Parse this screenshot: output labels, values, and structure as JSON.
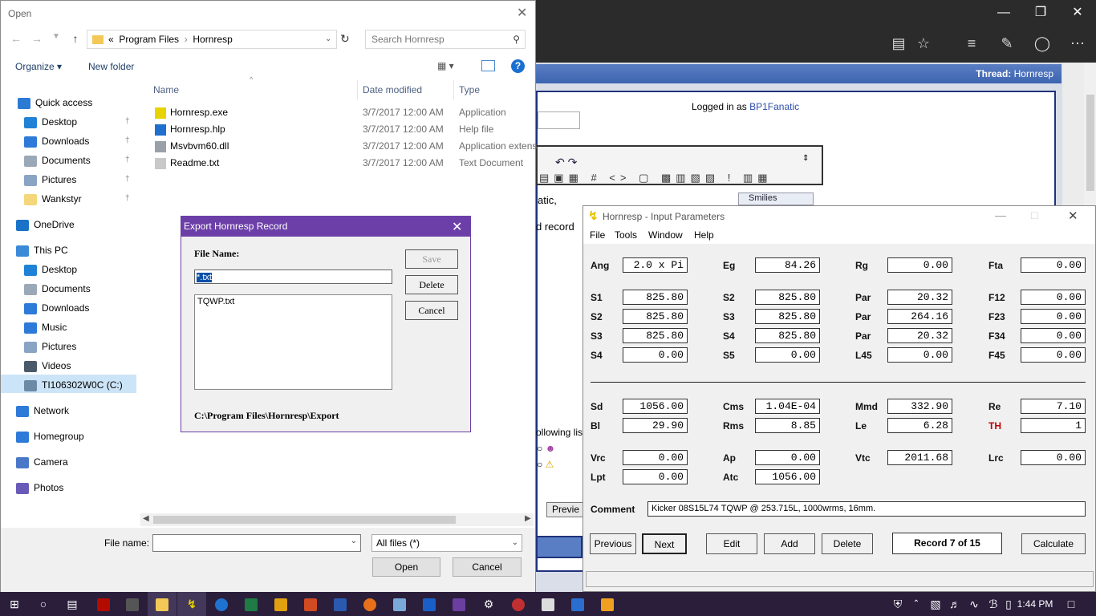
{
  "browser": {
    "thread_label": "Thread:",
    "thread_name": "Hornresp",
    "logged_in_text": "Logged in as",
    "username": "BP1Fanatic",
    "partial_text_1": "atic,",
    "partial_text_2": "d record",
    "following_text": "ollowing lis",
    "smilies_label": "Smilies",
    "preview_label": "Previe"
  },
  "open_dialog": {
    "title": "Open",
    "address": {
      "prefix": "«",
      "parts": [
        "Program Files",
        "Hornresp"
      ]
    },
    "search_placeholder": "Search Hornresp",
    "toolbar": {
      "organize": "Organize ▾",
      "new_folder": "New folder"
    },
    "nav": [
      {
        "label": "Quick access",
        "icon": "star-icon",
        "color": "#2b7ad4",
        "pinned": false
      },
      {
        "label": "Desktop",
        "icon": "desktop-icon",
        "color": "#1f82d6",
        "pinned": true
      },
      {
        "label": "Downloads",
        "icon": "download-icon",
        "color": "#2d7ad8",
        "pinned": true
      },
      {
        "label": "Documents",
        "icon": "documents-icon",
        "color": "#9aa8b8",
        "pinned": true
      },
      {
        "label": "Pictures",
        "icon": "pictures-icon",
        "color": "#8aa4c4",
        "pinned": true
      },
      {
        "label": "Wankstyr",
        "icon": "folder-icon",
        "color": "#f5d67a",
        "pinned": true
      },
      {
        "label": "OneDrive",
        "icon": "cloud-icon",
        "color": "#1a73c8",
        "pinned": false
      },
      {
        "label": "This PC",
        "icon": "computer-icon",
        "color": "#3a8ad8",
        "pinned": false
      },
      {
        "label": "Desktop",
        "icon": "desktop-icon",
        "color": "#1f82d6",
        "pinned": false
      },
      {
        "label": "Documents",
        "icon": "documents-icon",
        "color": "#9aa8b8",
        "pinned": false
      },
      {
        "label": "Downloads",
        "icon": "download-icon",
        "color": "#2d7ad8",
        "pinned": false
      },
      {
        "label": "Music",
        "icon": "music-icon",
        "color": "#2d7ad8",
        "pinned": false
      },
      {
        "label": "Pictures",
        "icon": "pictures-icon",
        "color": "#8aa4c4",
        "pinned": false
      },
      {
        "label": "Videos",
        "icon": "videos-icon",
        "color": "#4b5a6a",
        "pinned": false
      },
      {
        "label": "TI106302W0C (C:)",
        "icon": "drive-icon",
        "color": "#6a8aa6",
        "pinned": false
      },
      {
        "label": "Network",
        "icon": "network-icon",
        "color": "#2d7ad8",
        "pinned": false
      },
      {
        "label": "Homegroup",
        "icon": "homegroup-icon",
        "color": "#2d7ad8",
        "pinned": false
      },
      {
        "label": "Camera",
        "icon": "folder-icon",
        "color": "#4a78c8",
        "pinned": false
      },
      {
        "label": "Photos",
        "icon": "folder-icon",
        "color": "#6a5ab8",
        "pinned": false
      }
    ],
    "columns": [
      "Name",
      "Date modified",
      "Type"
    ],
    "files": [
      {
        "name": "Hornresp.exe",
        "date": "3/7/2017 12:00 AM",
        "type": "Application",
        "color": "#e8d200"
      },
      {
        "name": "Hornresp.hlp",
        "date": "3/7/2017 12:00 AM",
        "type": "Help file",
        "color": "#1f6fcf"
      },
      {
        "name": "Msvbvm60.dll",
        "date": "3/7/2017 12:00 AM",
        "type": "Application extens",
        "color": "#9aa0a8"
      },
      {
        "name": "Readme.txt",
        "date": "3/7/2017 12:00 AM",
        "type": "Text Document",
        "color": "#c8c8c8"
      }
    ],
    "file_name_label": "File name:",
    "file_name_value": "",
    "filter": "All files (*)",
    "open_btn": "Open",
    "cancel_btn": "Cancel"
  },
  "export_dialog": {
    "title": "Export Hornresp Record",
    "file_name_label": "File Name:",
    "file_name_value": "*.txt",
    "list": [
      "TQWP.txt"
    ],
    "path": "C:\\Program Files\\Hornresp\\Export",
    "save_btn": "Save",
    "delete_btn": "Delete",
    "cancel_btn": "Cancel"
  },
  "hornresp": {
    "title": "Hornresp - Input Parameters",
    "menu": [
      "File",
      "Tools",
      "Window",
      "Help"
    ],
    "params": [
      {
        "label": "Ang",
        "value": "2.0 x Pi"
      },
      {
        "label": "Eg",
        "value": "84.26"
      },
      {
        "label": "Rg",
        "value": "0.00"
      },
      {
        "label": "Fta",
        "value": "0.00"
      },
      {
        "label": "S1",
        "value": "825.80"
      },
      {
        "label": "S2",
        "value": "825.80"
      },
      {
        "label": "Par",
        "value": "20.32"
      },
      {
        "label": "F12",
        "value": "0.00"
      },
      {
        "label": "S2",
        "value": "825.80"
      },
      {
        "label": "S3",
        "value": "825.80"
      },
      {
        "label": "Par",
        "value": "264.16"
      },
      {
        "label": "F23",
        "value": "0.00"
      },
      {
        "label": "S3",
        "value": "825.80"
      },
      {
        "label": "S4",
        "value": "825.80"
      },
      {
        "label": "Par",
        "value": "20.32"
      },
      {
        "label": "F34",
        "value": "0.00"
      },
      {
        "label": "S4",
        "value": "0.00"
      },
      {
        "label": "S5",
        "value": "0.00"
      },
      {
        "label": "L45",
        "value": "0.00"
      },
      {
        "label": "F45",
        "value": "0.00"
      },
      {
        "label": "Sd",
        "value": "1056.00"
      },
      {
        "label": "Cms",
        "value": "1.04E-04"
      },
      {
        "label": "Mmd",
        "value": "332.90"
      },
      {
        "label": "Re",
        "value": "7.10"
      },
      {
        "label": "Bl",
        "value": "29.90"
      },
      {
        "label": "Rms",
        "value": "8.85"
      },
      {
        "label": "Le",
        "value": "6.28"
      },
      {
        "label": "TH",
        "value": "1"
      },
      {
        "label": "Vrc",
        "value": "0.00"
      },
      {
        "label": "Ap",
        "value": "0.00"
      },
      {
        "label": "Vtc",
        "value": "2011.68"
      },
      {
        "label": "Lrc",
        "value": "0.00"
      },
      {
        "label": "Lpt",
        "value": "0.00"
      },
      {
        "label": "Atc",
        "value": "1056.00"
      }
    ],
    "th_color": "#c00000",
    "comment_label": "Comment",
    "comment": "Kicker 08S15L74 TQWP @ 253.715L, 1000wrms, 16mm.",
    "buttons": [
      "Previous",
      "Next",
      "Edit",
      "Add",
      "Delete",
      "Calculate"
    ],
    "record": "Record 7 of 15"
  },
  "taskbar": {
    "time": "1:44 PM"
  }
}
